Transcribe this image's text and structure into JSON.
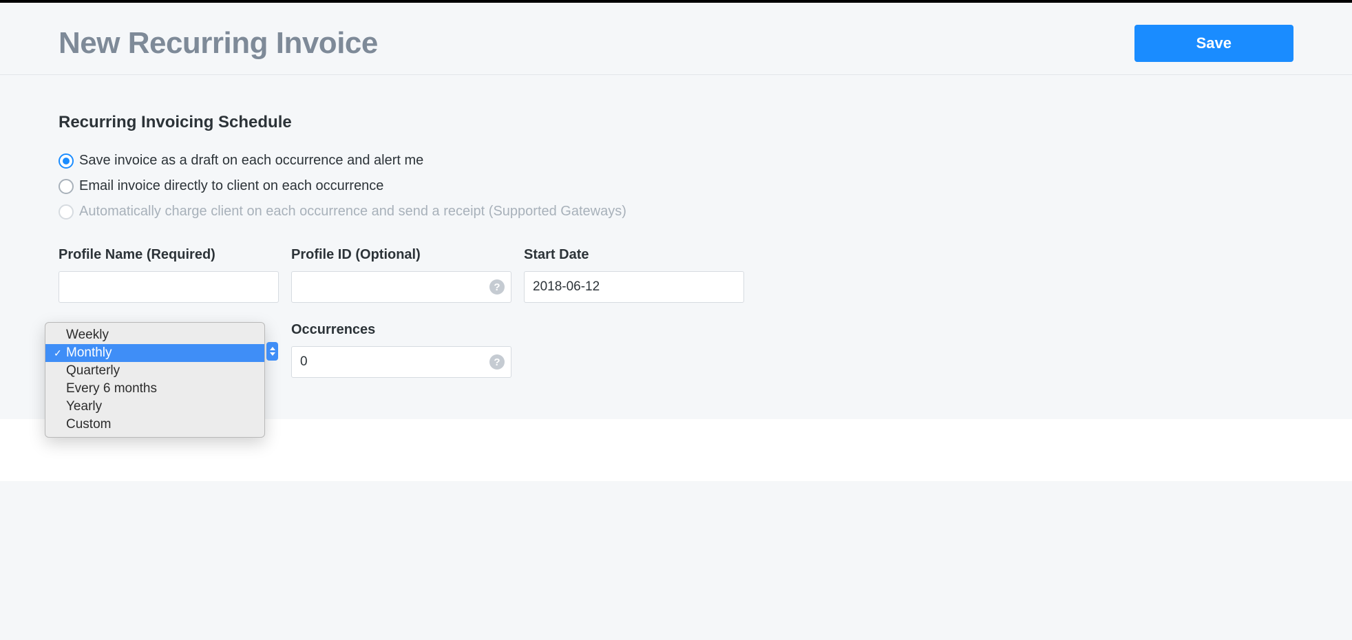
{
  "header": {
    "title": "New Recurring Invoice",
    "save_label": "Save"
  },
  "schedule": {
    "section_title": "Recurring Invoicing Schedule",
    "options": [
      {
        "label": "Save invoice as a draft on each occurrence and alert me",
        "selected": true
      },
      {
        "label": "Email invoice directly to client on each occurrence",
        "selected": false
      },
      {
        "label": "Automatically charge client on each occurrence and send a receipt (Supported Gateways)",
        "selected": false,
        "disabled": true
      }
    ]
  },
  "fields": {
    "profile_name": {
      "label": "Profile Name (Required)",
      "value": ""
    },
    "profile_id": {
      "label": "Profile ID (Optional)",
      "value": ""
    },
    "start_date": {
      "label": "Start Date",
      "value": "2018-06-12"
    },
    "occurrences": {
      "label": "Occurrences",
      "value": "0"
    }
  },
  "frequency_dropdown": {
    "options": [
      "Weekly",
      "Monthly",
      "Quarterly",
      "Every 6 months",
      "Yearly",
      "Custom"
    ],
    "selected": "Monthly"
  }
}
